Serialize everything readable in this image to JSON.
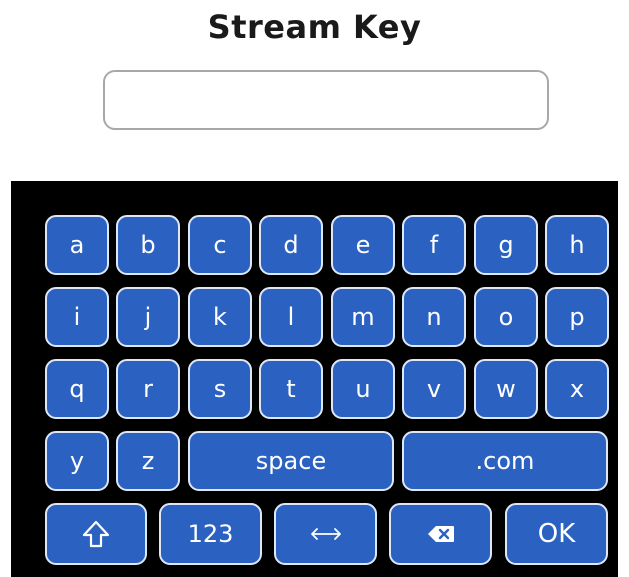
{
  "title": "Stream Key",
  "input": {
    "value": "",
    "placeholder": ""
  },
  "keyboard": {
    "rows": [
      [
        "a",
        "b",
        "c",
        "d",
        "e",
        "f",
        "g",
        "h"
      ],
      [
        "i",
        "j",
        "k",
        "l",
        "m",
        "n",
        "o",
        "p"
      ],
      [
        "q",
        "r",
        "s",
        "t",
        "u",
        "v",
        "w",
        "x"
      ]
    ],
    "row4": {
      "y": "y",
      "z": "z",
      "space": "space",
      "dotcom": ".com"
    },
    "bottom": {
      "shift_icon": "shift-up-arrow-icon",
      "numbers": "123",
      "toggle_icon": "left-right-arrow-icon",
      "backspace_icon": "backspace-icon",
      "ok": "OK"
    }
  },
  "colors": {
    "key_fill": "#2b62c2",
    "key_border": "#dfe7f7",
    "keyboard_bg": "#000000"
  }
}
